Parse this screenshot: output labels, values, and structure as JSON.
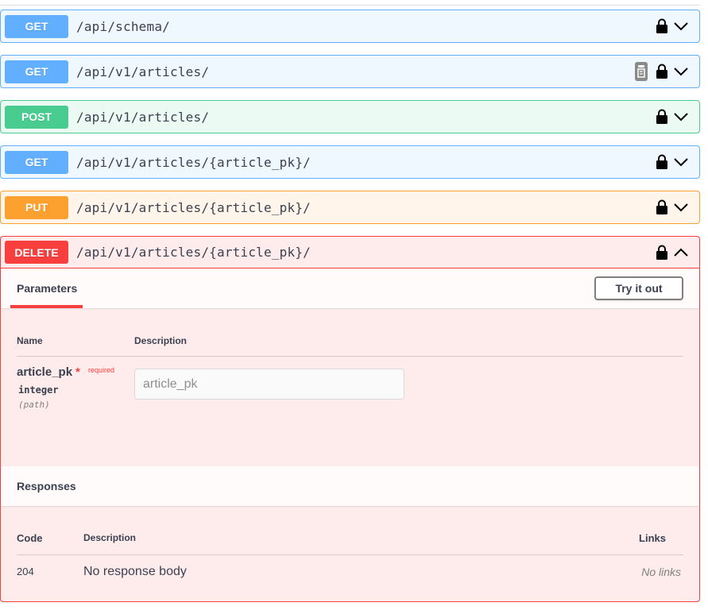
{
  "operations": [
    {
      "method": "GET",
      "path": "/api/schema/"
    },
    {
      "method": "GET",
      "path": "/api/v1/articles/"
    },
    {
      "method": "POST",
      "path": "/api/v1/articles/"
    },
    {
      "method": "GET",
      "path": "/api/v1/articles/{article_pk}/"
    },
    {
      "method": "PUT",
      "path": "/api/v1/articles/{article_pk}/"
    },
    {
      "method": "DELETE",
      "path": "/api/v1/articles/{article_pk}/"
    }
  ],
  "expanded": {
    "tab_label": "Parameters",
    "try_button": "Try it out",
    "col_name": "Name",
    "col_description": "Description",
    "param": {
      "name": "article_pk",
      "required_star": "*",
      "required_label": "required",
      "type": "integer",
      "in": "(path)",
      "placeholder": "article_pk"
    },
    "responses_title": "Responses",
    "resp_col_code": "Code",
    "resp_col_description": "Description",
    "resp_col_links": "Links",
    "response": {
      "code": "204",
      "description": "No response body",
      "links": "No links"
    }
  },
  "colors": {
    "get": "#61affe",
    "post": "#49cc90",
    "put": "#fca130",
    "delete": "#f93e3e"
  },
  "icons": [
    "lock-icon",
    "chevron-down-icon",
    "chevron-up-icon",
    "clipboard-icon"
  ]
}
